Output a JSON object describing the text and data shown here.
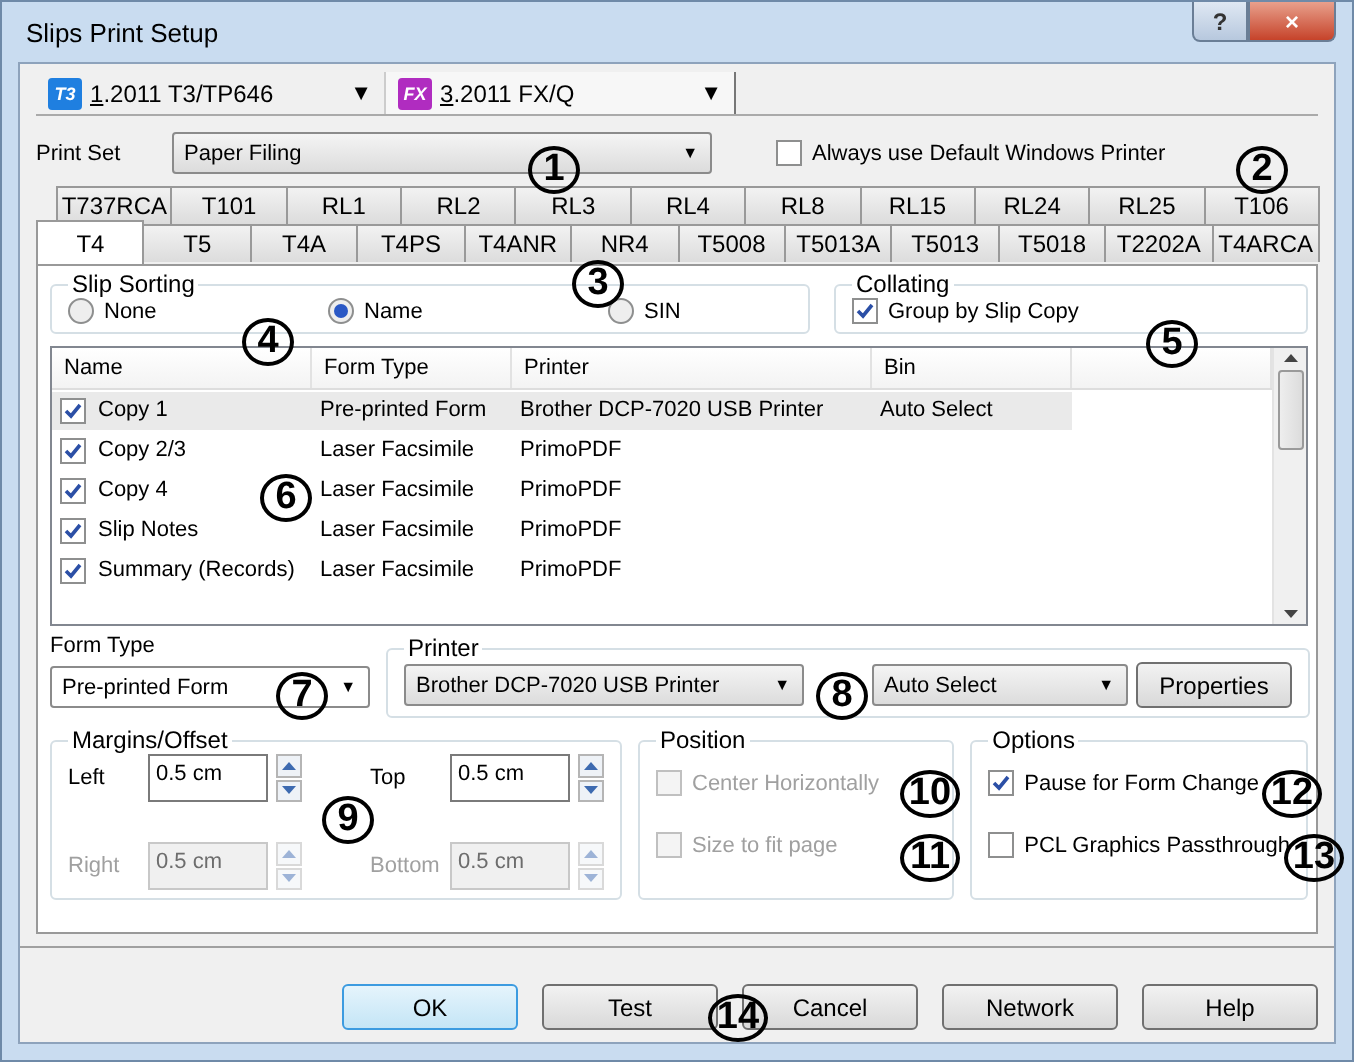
{
  "window": {
    "title": "Slips Print Setup",
    "help": "?",
    "close": "×"
  },
  "documents": [
    {
      "icon": "T3",
      "color": "#1f7fe0",
      "accel": "1",
      "label": ".2011 T3/TP646",
      "caret": "▼",
      "selected": false
    },
    {
      "icon": "FX",
      "color": "#b02cc0",
      "accel": "3",
      "label": ".2011 FX/Q",
      "caret": "▼",
      "selected": true
    }
  ],
  "print_set": {
    "label": "Print Set",
    "value": "Paper Filing",
    "caret": "▼"
  },
  "default_printer": {
    "label": "Always use Default Windows Printer",
    "checked": false
  },
  "tab_rows": [
    [
      {
        "label": "T737RCA",
        "selected": false
      },
      {
        "label": "T101",
        "selected": false
      },
      {
        "label": "RL1",
        "selected": false
      },
      {
        "label": "RL2",
        "selected": false
      },
      {
        "label": "RL3",
        "selected": false
      },
      {
        "label": "RL4",
        "selected": false
      },
      {
        "label": "RL8",
        "selected": false
      },
      {
        "label": "RL15",
        "selected": false
      },
      {
        "label": "RL24",
        "selected": false
      },
      {
        "label": "RL25",
        "selected": false
      },
      {
        "label": "T106",
        "selected": false
      }
    ],
    [
      {
        "label": "T4",
        "selected": true
      },
      {
        "label": "T5",
        "selected": false
      },
      {
        "label": "T4A",
        "selected": false
      },
      {
        "label": "T4PS",
        "selected": false
      },
      {
        "label": "T4ANR",
        "selected": false
      },
      {
        "label": "NR4",
        "selected": false
      },
      {
        "label": "T5008",
        "selected": false
      },
      {
        "label": "T5013A",
        "selected": false
      },
      {
        "label": "T5013",
        "selected": false
      },
      {
        "label": "T5018",
        "selected": false
      },
      {
        "label": "T2202A",
        "selected": false
      },
      {
        "label": "T4ARCA",
        "selected": false
      }
    ]
  ],
  "slip_sorting": {
    "title": "Slip Sorting",
    "options": [
      {
        "label": "None",
        "selected": false
      },
      {
        "label": "Name",
        "selected": true
      },
      {
        "label": "SIN",
        "selected": false
      }
    ]
  },
  "collating": {
    "title": "Collating",
    "label": "Group by Slip Copy",
    "checked": true
  },
  "table": {
    "columns": [
      "Name",
      "Form Type",
      "Printer",
      "Bin"
    ],
    "rows": [
      {
        "checked": true,
        "selected": true,
        "cells": [
          "Copy 1",
          "Pre-printed Form",
          "Brother DCP-7020 USB Printer",
          "Auto Select"
        ]
      },
      {
        "checked": true,
        "selected": false,
        "cells": [
          "Copy 2/3",
          "Laser Facsimile",
          "PrimoPDF",
          ""
        ]
      },
      {
        "checked": true,
        "selected": false,
        "cells": [
          "Copy 4",
          "Laser Facsimile",
          "PrimoPDF",
          ""
        ]
      },
      {
        "checked": true,
        "selected": false,
        "cells": [
          "Slip Notes",
          "Laser Facsimile",
          "PrimoPDF",
          ""
        ]
      },
      {
        "checked": true,
        "selected": false,
        "cells": [
          "Summary (Records)",
          "Laser Facsimile",
          "PrimoPDF",
          ""
        ]
      }
    ]
  },
  "form_type": {
    "label": "Form Type",
    "value": "Pre-printed Form",
    "caret": "▼"
  },
  "printer": {
    "title": "Printer",
    "printer": "Brother DCP-7020 USB Printer",
    "bin": "Auto Select",
    "caret": "▼",
    "button": "Properties"
  },
  "margins": {
    "title": "Margins/Offset",
    "fields": [
      {
        "label": "Left",
        "value": "0.5 cm",
        "disabled": false
      },
      {
        "label": "Top",
        "value": "0.5 cm",
        "disabled": false
      },
      {
        "label": "Right",
        "value": "0.5 cm",
        "disabled": true
      },
      {
        "label": "Bottom",
        "value": "0.5 cm",
        "disabled": true
      }
    ]
  },
  "position": {
    "title": "Position",
    "options": [
      {
        "label": "Center Horizontally",
        "checked": false,
        "disabled": true
      },
      {
        "label": "Size to fit page",
        "checked": false,
        "disabled": true
      }
    ]
  },
  "options": {
    "title": "Options",
    "options": [
      {
        "label": "Pause for Form Change",
        "checked": true,
        "disabled": false
      },
      {
        "label": "PCL Graphics Passthrough",
        "checked": false,
        "disabled": false
      }
    ]
  },
  "buttons": [
    {
      "label": "OK",
      "default": true
    },
    {
      "label": "Test",
      "default": false
    },
    {
      "label": "Cancel",
      "default": false
    },
    {
      "label": "Network",
      "default": false
    },
    {
      "label": "Help",
      "default": false
    }
  ],
  "callouts": [
    "1",
    "2",
    "3",
    "4",
    "5",
    "6",
    "7",
    "8",
    "9",
    "10",
    "11",
    "12",
    "13",
    "14"
  ]
}
